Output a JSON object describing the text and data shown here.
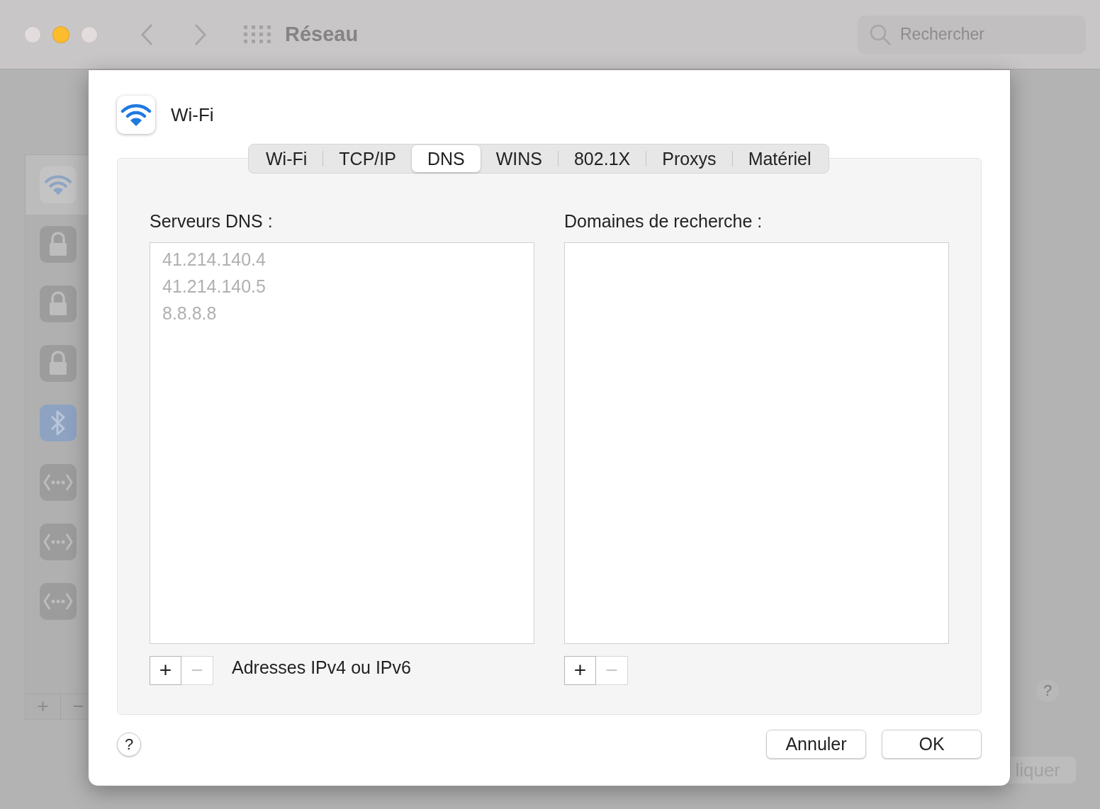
{
  "window": {
    "title": "Réseau",
    "traffic_lights": [
      {
        "color": "#e3dcdc"
      },
      {
        "color": "#fdbc2e"
      },
      {
        "color": "#e3dcdc"
      }
    ],
    "search": {
      "placeholder": "Rechercher"
    }
  },
  "background": {
    "sidebar_items": [
      {
        "kind": "wifi",
        "selected": true
      },
      {
        "kind": "lock",
        "selected": false
      },
      {
        "kind": "lock",
        "selected": false
      },
      {
        "kind": "lock",
        "selected": false
      },
      {
        "kind": "bluetooth",
        "selected": false
      },
      {
        "kind": "ethernet",
        "selected": false
      },
      {
        "kind": "ethernet",
        "selected": false
      },
      {
        "kind": "ethernet",
        "selected": false
      }
    ],
    "add": "+",
    "remove": "−",
    "help": "?",
    "apply_button": "liquer"
  },
  "dialog": {
    "title": "Wi-Fi",
    "tabs": [
      {
        "label": "Wi-Fi",
        "selected": false
      },
      {
        "label": "TCP/IP",
        "selected": false
      },
      {
        "label": "DNS",
        "selected": true
      },
      {
        "label": "WINS",
        "selected": false
      },
      {
        "label": "802.1X",
        "selected": false
      },
      {
        "label": "Proxys",
        "selected": false
      },
      {
        "label": "Matériel",
        "selected": false
      }
    ],
    "dns_servers": {
      "label": "Serveurs DNS :",
      "entries": [
        {
          "text": "41.214.140.4",
          "disabled": true
        },
        {
          "text": "41.214.140.5",
          "disabled": true
        },
        {
          "text": "8.8.8.8",
          "disabled": true
        }
      ],
      "add": {
        "text": "+",
        "disabled": false
      },
      "remove": {
        "text": "−",
        "disabled": true
      },
      "hint": "Adresses IPv4 ou IPv6"
    },
    "search_domains": {
      "label": "Domaines de recherche :",
      "add": {
        "text": "+",
        "disabled": false
      },
      "remove": {
        "text": "−",
        "disabled": true
      }
    },
    "help": "?",
    "buttons": [
      "Annuler",
      "OK"
    ]
  }
}
